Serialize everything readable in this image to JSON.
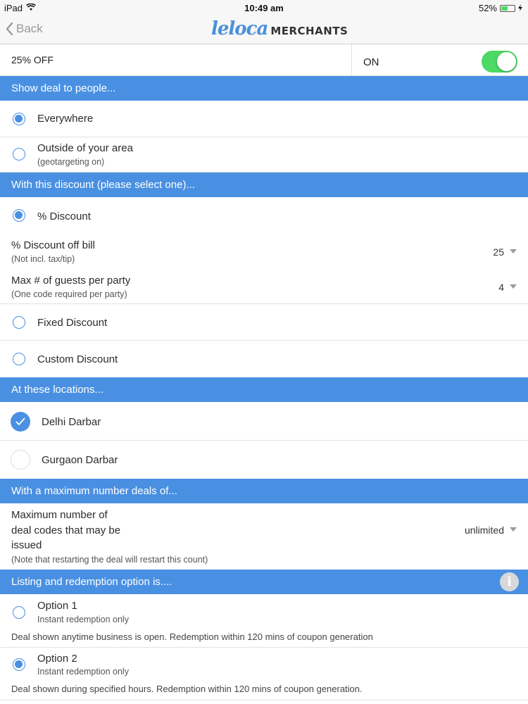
{
  "status_bar": {
    "device": "iPad",
    "time": "10:49 am",
    "battery": "52%",
    "battery_level": 0.52
  },
  "nav": {
    "back_label": "Back",
    "logo_script": "leloca",
    "logo_text": "MERCHANTS"
  },
  "deal": {
    "title": "25% OFF",
    "toggle_label": "ON",
    "toggle_on": true
  },
  "sections": {
    "audience": "Show deal to people...",
    "discount": "With this discount (please select one)...",
    "locations": "At these locations...",
    "maximum": "With a maximum number deals of...",
    "listing": "Listing and redemption option is...."
  },
  "audience_options": [
    {
      "label": "Everywhere",
      "selected": true
    },
    {
      "label": "Outside of your area",
      "sub": "(geotargeting on)",
      "selected": false
    }
  ],
  "discount_options": {
    "percent": {
      "label": "% Discount",
      "selected": true
    },
    "discount_off_bill": {
      "label": "% Discount off bill",
      "sub": "(Not incl. tax/tip)",
      "value": "25"
    },
    "max_guests": {
      "label": "Max # of guests per party",
      "sub": "(One code required per party)",
      "value": "4"
    },
    "fixed": {
      "label": "Fixed Discount",
      "selected": false
    },
    "custom": {
      "label": "Custom Discount",
      "selected": false
    }
  },
  "locations": [
    {
      "label": "Delhi Darbar",
      "checked": true
    },
    {
      "label": "Gurgaon Darbar",
      "checked": false
    }
  ],
  "maximum": {
    "line1": "Maximum number of",
    "line2": "deal codes that may be",
    "line3": "issued",
    "note": "(Note that restarting the deal will restart this count)",
    "value": "unlimited"
  },
  "listing_options": [
    {
      "label": "Option 1",
      "sub": "Instant redemption only",
      "desc": "Deal shown anytime business is open. Redemption within 120 mins of coupon generation",
      "selected": false
    },
    {
      "label": "Option 2",
      "sub": "Instant redemption only",
      "desc": "Deal shown during specified hours. Redemption within 120 mins of coupon generation.",
      "selected": true
    }
  ],
  "colors": {
    "accent": "#4a90e2",
    "toggle": "#4cd964"
  }
}
